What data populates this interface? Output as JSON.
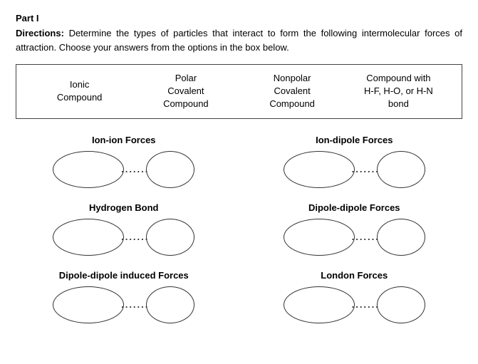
{
  "header": {
    "part": "Part I",
    "directions_bold": "Directions:",
    "directions_text": " Determine the types of particles that interact to form the following intermolecular forces of attraction. Choose your answers from the options in the box below."
  },
  "options": [
    {
      "label": "Ionic\nCompound"
    },
    {
      "label": "Polar\nCovalent\nCompound"
    },
    {
      "label": "Nonpolar\nCovalent\nCompound"
    },
    {
      "label": "Compound with\nH-F, H-O, or H-N\nbond"
    }
  ],
  "forces": [
    {
      "title": "Ion-ion Forces"
    },
    {
      "title": "Ion-dipole Forces"
    },
    {
      "title": "Hydrogen Bond"
    },
    {
      "title": "Dipole-dipole Forces"
    },
    {
      "title": "Dipole-dipole induced Forces"
    },
    {
      "title": "London Forces"
    }
  ]
}
